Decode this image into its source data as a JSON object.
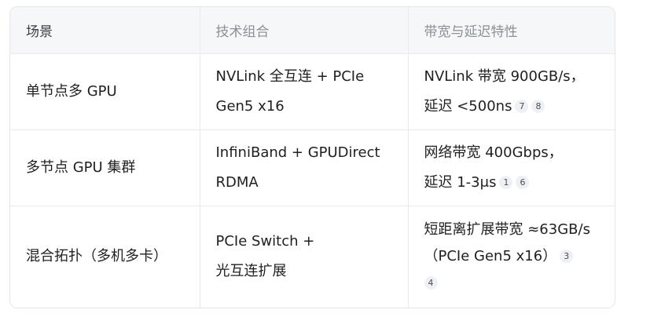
{
  "table": {
    "headers": [
      "场景",
      "技术组合",
      "带宽与延迟特性"
    ],
    "rows": [
      {
        "scenario": "单节点多 GPU",
        "tech": [
          "NVLink 全互连 + PCIe",
          "Gen5 x16"
        ],
        "bandwidth": [
          "NVLink 带宽 900GB/s，",
          "延迟 <500ns"
        ],
        "cites": [
          "7",
          "8"
        ]
      },
      {
        "scenario": "多节点 GPU 集群",
        "tech": [
          "InfiniBand + GPUDirect",
          "RDMA"
        ],
        "bandwidth": [
          "网络带宽 400Gbps，",
          "延迟 1-3μs"
        ],
        "cites": [
          "1",
          "6"
        ]
      },
      {
        "scenario": "混合拓扑（多机多卡）",
        "tech": [
          "PCIe Switch +",
          "光互连扩展"
        ],
        "bandwidth": [
          "短距离扩展带宽 ≈63GB/s",
          "（PCIe Gen5 x16）"
        ],
        "cites": [
          "3",
          "4"
        ]
      }
    ]
  }
}
